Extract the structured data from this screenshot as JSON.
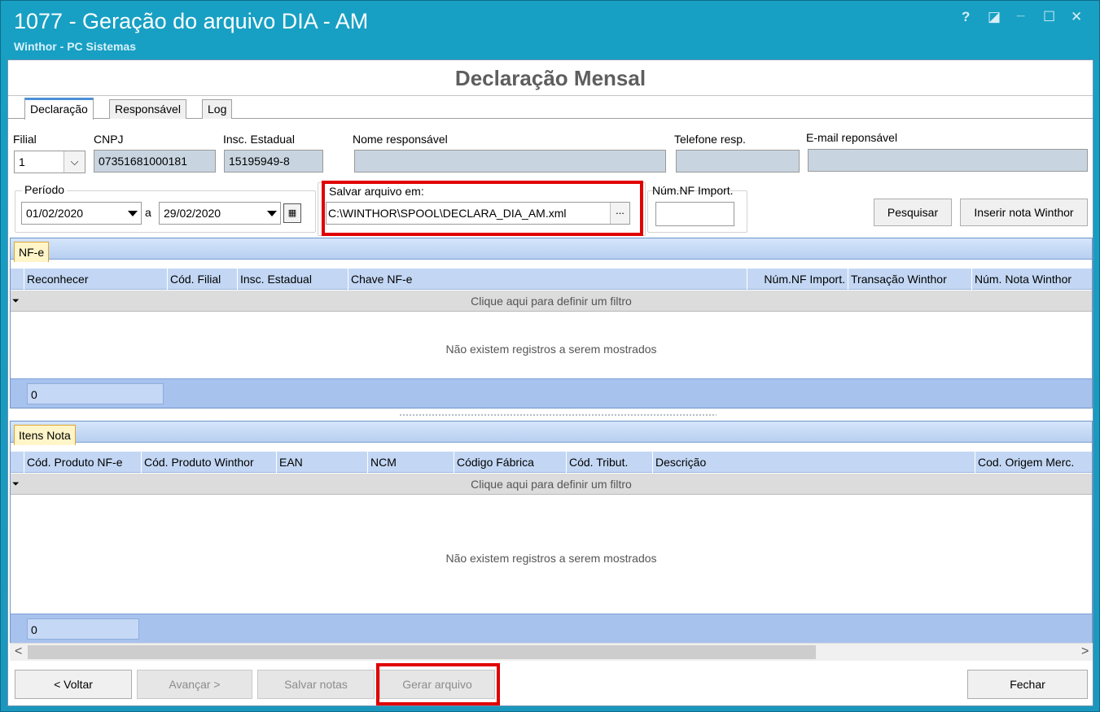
{
  "window": {
    "title": "1077 - Geração do arquivo DIA - AM",
    "subtitle": "Winthor - PC Sistemas",
    "controls": [
      "?",
      "◪",
      "_",
      "☐",
      "✕"
    ]
  },
  "header": {
    "title": "Declaração Mensal"
  },
  "tabs": [
    {
      "label": "Declaração",
      "active": true
    },
    {
      "label": "Responsável",
      "active": false
    },
    {
      "label": "Log",
      "active": false
    }
  ],
  "form": {
    "filial": {
      "label": "Filial",
      "value": "1"
    },
    "cnpj": {
      "label": "CNPJ",
      "value": "07351681000181"
    },
    "insc_estadual": {
      "label": "Insc. Estadual",
      "value": "15195949-8"
    },
    "nome_responsavel": {
      "label": "Nome responsável",
      "value": ""
    },
    "telefone": {
      "label": "Telefone resp.",
      "value": ""
    },
    "email": {
      "label": "E-mail reponsável",
      "value": ""
    },
    "periodo": {
      "label": "Período",
      "start": "01/02/2020",
      "separator": "a",
      "end": "29/02/2020"
    },
    "salvar": {
      "label": "Salvar arquivo em:",
      "value": "C:\\WINTHOR\\SPOOL\\DECLARA_DIA_AM.xml",
      "browse": "..."
    },
    "num_nf_import": {
      "label": "Núm.NF Import.",
      "value": ""
    },
    "pesquisar": "Pesquisar",
    "inserir_nota": "Inserir nota Winthor"
  },
  "grid_nfe": {
    "tab": "NF-e",
    "columns": [
      "Reconhecer",
      "Cód. Filial",
      "Insc. Estadual",
      "Chave NF-e",
      "Núm.NF Import.",
      "Transação Winthor",
      "Núm. Nota Winthor"
    ],
    "filter_text": "Clique aqui para definir um filtro",
    "empty_text": "Não existem registros a serem mostrados",
    "count": "0"
  },
  "grid_itens": {
    "tab": "Itens Nota",
    "columns": [
      "Cód. Produto NF-e",
      "Cód. Produto Winthor",
      "EAN",
      "NCM",
      "Código Fábrica",
      "Cód. Tribut.",
      "Descrição",
      "Cod. Origem Merc."
    ],
    "filter_text": "Clique aqui para definir um filtro",
    "empty_text": "Não existem registros a serem mostrados",
    "count": "0"
  },
  "scroll": {
    "left": "<",
    "right": ">"
  },
  "buttons": {
    "voltar": "< Voltar",
    "avancar": "Avançar >",
    "salvar_notas": "Salvar notas",
    "gerar": "Gerar arquivo",
    "fechar": "Fechar"
  },
  "colors": {
    "title_bar": "#17a0c4",
    "highlight": "#e00000",
    "grid_header": "#c3d7f4"
  }
}
